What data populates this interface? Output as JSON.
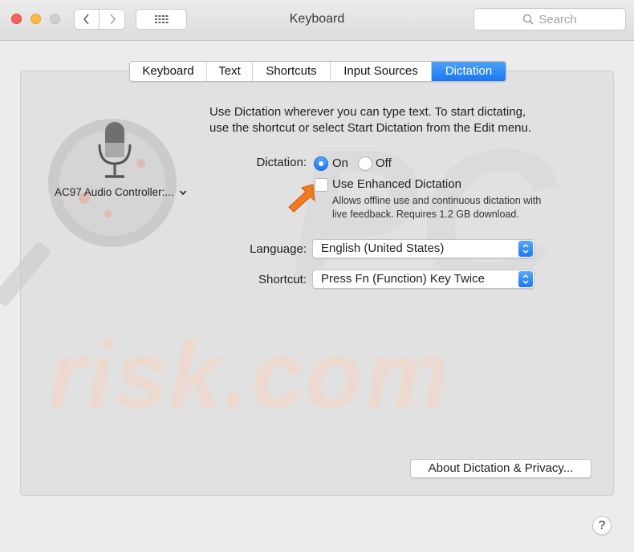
{
  "window": {
    "title": "Keyboard"
  },
  "search": {
    "placeholder": "Search"
  },
  "tabs": [
    {
      "label": "Keyboard",
      "selected": false
    },
    {
      "label": "Text",
      "selected": false
    },
    {
      "label": "Shortcuts",
      "selected": false
    },
    {
      "label": "Input Sources",
      "selected": false
    },
    {
      "label": "Dictation",
      "selected": true
    }
  ],
  "mic": {
    "source_label": "AC97 Audio Controller:..."
  },
  "description": {
    "line1": "Use Dictation wherever you can type text. To start dictating,",
    "line2": "use the shortcut or select Start Dictation from the Edit menu."
  },
  "dictation": {
    "label": "Dictation:",
    "on_label": "On",
    "off_label": "Off",
    "selected": "On"
  },
  "enhanced": {
    "label": "Use Enhanced Dictation",
    "checked": false,
    "help_line1": "Allows offline use and continuous dictation with",
    "help_line2": "live feedback. Requires 1.2 GB download."
  },
  "language": {
    "label": "Language:",
    "value": "English (United States)"
  },
  "shortcut": {
    "label": "Shortcut:",
    "value": "Press Fn (Function) Key Twice"
  },
  "buttons": {
    "about_label": "About Dictation & Privacy...",
    "help_label": "?"
  },
  "watermark": {
    "text": "risk.com",
    "pc_text": "PC"
  },
  "colors": {
    "accent": "#1877f2",
    "arrow": "#f47a20",
    "close": "#fc605c",
    "minimize": "#fdbc40"
  }
}
